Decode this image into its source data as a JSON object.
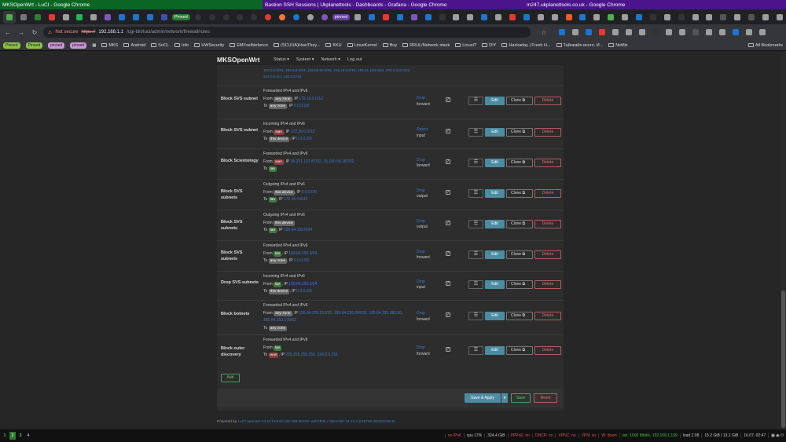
{
  "os_titles": [
    {
      "text": "MKSOpenWrt - LuCI - Google Chrome",
      "color": "#0b6623",
      "width": 334
    },
    {
      "text": "Bastion SSH Sessions | Ukplanettools - Dashboards - Grafana - Google Chrome",
      "color": "#4a148c",
      "width": 333
    },
    {
      "text": "m247.ukplanettools.co.uk - Google Chrome",
      "color": "#4a148c",
      "width": 333
    }
  ],
  "pinned_tab_label": "Pinned",
  "pinned_tab_label2": "pinned",
  "address": {
    "not_secure": "Not secure",
    "scheme": "https://",
    "host": "192.168.1.1",
    "path": "/cgi-bin/luci/admin/network/firewall/rules"
  },
  "bookmarks": {
    "pills": [
      "Pinned",
      "Pinned",
      "pinned",
      "pinned"
    ],
    "items": [
      "MKS",
      "Android",
      "SoCL",
      "Info",
      "HWSecurity",
      "EMFselfdefence",
      "(SCUUA)HowThey...",
      "KKU",
      "LinuxKernel",
      "Buy",
      "RRUL/Network stack",
      "LinuxIT",
      "DIY",
      "Hackaday | Fresh H...",
      "Тайнкайн всего. И...",
      "Netflix"
    ],
    "all_bookmarks": "All Bookmarks"
  },
  "luci": {
    "brand": "MKSOpenWrt",
    "menu": [
      "Status ▾",
      "System ▾",
      "Network ▾",
      "Log out"
    ],
    "pre_ips": "150.0.0.0/24, 192.0.2.0/24, 192.88.99.0/24, 198.18.0.0/15, 198.51.100.0/24, 203.0.113.0/24, 224.0.0.0/4, 240.0.0.0/4"
  },
  "rules": [
    {
      "name": "Block SVS subnet",
      "l1": "Forwarded IPv4 and IPv6",
      "from_zone": "any zone",
      "from_ip": "172.16.0.0/12",
      "to_zone": "any zone",
      "to_ip": "0.0.0.0/0",
      "action": "Drop",
      "chain": "forward",
      "from_type": "any",
      "to_type": "any"
    },
    {
      "name": "Block SVS subnet",
      "l1": "Incoming IPv4 and IPv6",
      "from_zone": "wan",
      "from_ip": "172.16.0.0/12",
      "to_zone": "this device",
      "to_ip": "0.0.0.0/0",
      "action": "Reject",
      "chain": "input",
      "from_type": "wan",
      "to_type": "dev"
    },
    {
      "name": "Block Scientology",
      "l1": "Forwarded IPv4 and IPv6",
      "from_zone": "wan",
      "from_ip": "35.201.137.87/32, 35.190.56.182/32",
      "to_zone": "lan",
      "to_ip": "",
      "action": "Drop",
      "chain": "forward",
      "from_type": "wan",
      "to_type": "lan"
    },
    {
      "name": "Block SVS subnets",
      "l1": "Outgoing IPv4 and IPv6",
      "from_zone": "this device",
      "from_ip": "0.0.0.0/0",
      "to_zone": "lan",
      "to_ip": "172.16.0.0/12",
      "action": "Drop",
      "chain": "output",
      "from_type": "dev",
      "to_type": "lan"
    },
    {
      "name": "Block SVS subnets",
      "l1": "Outgoing IPv4 and IPv6",
      "from_zone": "this device",
      "from_ip": "",
      "to_zone": "lan",
      "to_ip": "100.64.192.0/24",
      "action": "Drop",
      "chain": "output",
      "from_type": "dev",
      "to_type": "lan"
    },
    {
      "name": "Block SVS subnets",
      "l1": "Forwarded IPv4 and IPv6",
      "from_zone": "lan",
      "from_ip": "100.64.192.0/24",
      "to_zone": "any zone",
      "to_ip": "0.0.0.0/0",
      "action": "Drop",
      "chain": "forward",
      "from_type": "lan",
      "to_type": "any"
    },
    {
      "name": "Drop SVS subnets",
      "l1": "Incoming IPv4 and IPv6",
      "from_zone": "lan",
      "from_ip": "100.64.192.0/24",
      "to_zone": "this device",
      "to_ip": "0.0.0.0/0",
      "action": "Drop",
      "chain": "input",
      "from_type": "lan",
      "to_type": "dev"
    },
    {
      "name": "Block botnets",
      "l1": "Forwarded IPv4 and IPv6",
      "from_zone": "any zone",
      "from_ip": "195.64.220.212/32, 199.64.226.26/032, 185.64.233.38/130, 185.64.253.178/32",
      "to_zone": "any zone",
      "to_ip": "",
      "action": "Drop",
      "chain": "forward",
      "from_type": "any",
      "to_type": "any"
    },
    {
      "name": "Block outer discovery",
      "l1": "Forwarded IPv4 and IPv6",
      "from_zone": "lan",
      "from_ip": "",
      "to_zone": "wan",
      "to_ip": "255.255.255.255, 224.0.0.251",
      "action": "Drop",
      "chain": "forward",
      "from_type": "lan",
      "to_type": "wan"
    }
  ],
  "labels": {
    "from": "From",
    "to": "To",
    "ip": "IP",
    "drag": "☰",
    "edit": "Edit",
    "clone": "Clone",
    "delete": "Delete",
    "add": "Add",
    "check": "✓"
  },
  "footer": {
    "save_apply": "Save & Apply",
    "save": "Save",
    "reset": "Reset",
    "powered_prefix": "Powered by",
    "powered_link": "LuCI openwrt-24.10 branch (25.168.50434~a6b1f96) / OpenWrt 24.10.2 (r28739-d9340319c6)"
  },
  "taskbar": {
    "workspaces": [
      "1",
      "2",
      "3",
      "4"
    ],
    "stats": [
      {
        "text": "no IPv6",
        "color": "#e05050"
      },
      {
        "text": "cpu 17%",
        "color": "#cccccc"
      },
      {
        "text": "324.4 GiB",
        "color": "#cccccc"
      },
      {
        "text": "PPPoE: no",
        "color": "#e05050"
      },
      {
        "text": "DHCP: no",
        "color": "#e05050"
      },
      {
        "text": "VPNC: no",
        "color": "#e05050"
      },
      {
        "text": "VPN: no",
        "color": "#e05050"
      },
      {
        "text": "W: down",
        "color": "#e05050"
      },
      {
        "text": "lan: 1000 Mbit/s, 192.168.1.199",
        "color": "#40c040"
      },
      {
        "text": "load 2.08",
        "color": "#cccccc"
      },
      {
        "text": "15.2 GiB | 13.1 GiB",
        "color": "#cccccc"
      },
      {
        "text": "16.07. 02:47",
        "color": "#cccccc"
      }
    ]
  }
}
